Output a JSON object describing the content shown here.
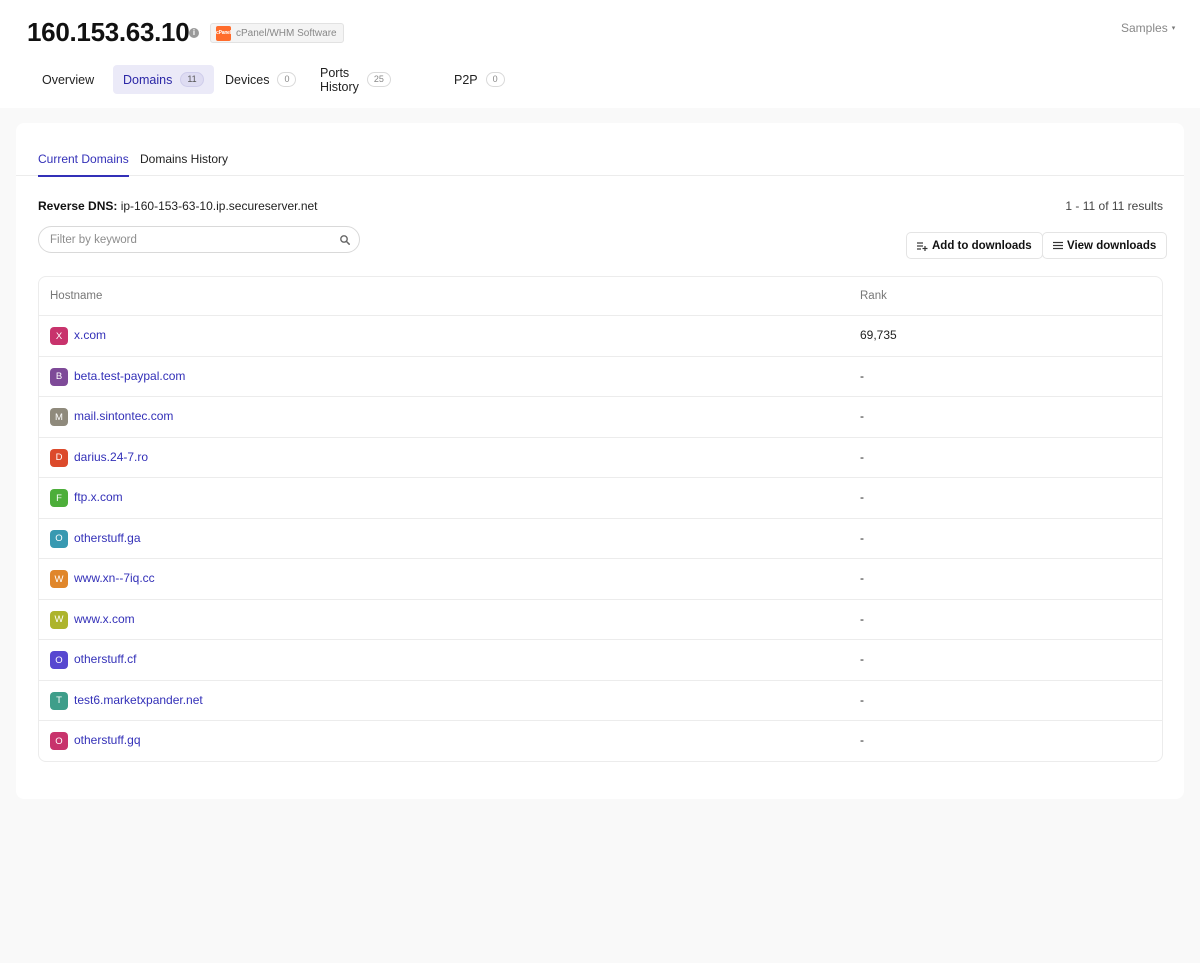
{
  "header": {
    "ip": "160.153.63.10",
    "info_icon": "i",
    "software_logo_text": "cPanel",
    "software": "cPanel/WHM Software",
    "samples_label": "Samples",
    "samples_caret": "▾",
    "tabs": [
      {
        "label": "Overview",
        "count": null,
        "active": false
      },
      {
        "label": "Domains",
        "count": "11",
        "active": true
      },
      {
        "label": "Devices",
        "count": "0",
        "active": false
      },
      {
        "label": "Ports History",
        "count": "25",
        "active": false
      },
      {
        "label": "P2P",
        "count": "0",
        "active": false
      }
    ]
  },
  "domains": {
    "subtabs": [
      {
        "label": "Current Domains",
        "active": true
      },
      {
        "label": "Domains History",
        "active": false
      }
    ],
    "reverse_dns_label": "Reverse DNS:",
    "reverse_dns_value": "ip-160-153-63-10.ip.secureserver.net",
    "results_text": "1 - 11 of 11 results",
    "filter_placeholder": "Filter by keyword",
    "add_downloads_label": "Add to downloads",
    "view_downloads_label": "View downloads",
    "columns": {
      "hostname": "Hostname",
      "rank": "Rank"
    },
    "rows": [
      {
        "letter": "X",
        "color": "#c8336c",
        "host": "x.com",
        "rank": "69,735"
      },
      {
        "letter": "B",
        "color": "#7e4a98",
        "host": "beta.test-paypal.com",
        "rank": "-"
      },
      {
        "letter": "M",
        "color": "#8f8a7c",
        "host": "mail.sintontec.com",
        "rank": "-"
      },
      {
        "letter": "D",
        "color": "#dc4a2b",
        "host": "darius.24-7.ro",
        "rank": "-"
      },
      {
        "letter": "F",
        "color": "#4dae3a",
        "host": "ftp.x.com",
        "rank": "-"
      },
      {
        "letter": "O",
        "color": "#3899b1",
        "host": "otherstuff.ga",
        "rank": "-"
      },
      {
        "letter": "W",
        "color": "#e0862a",
        "host": "www.xn--7iq.cc",
        "rank": "-"
      },
      {
        "letter": "W",
        "color": "#adb42c",
        "host": "www.x.com",
        "rank": "-"
      },
      {
        "letter": "O",
        "color": "#5747d0",
        "host": "otherstuff.cf",
        "rank": "-"
      },
      {
        "letter": "T",
        "color": "#3e9e8a",
        "host": "test6.marketxpander.net",
        "rank": "-"
      },
      {
        "letter": "O",
        "color": "#c8336c",
        "host": "otherstuff.gq",
        "rank": "-"
      }
    ]
  }
}
